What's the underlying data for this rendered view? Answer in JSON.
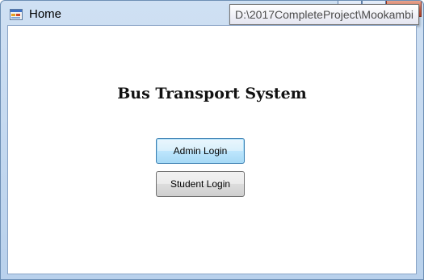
{
  "window": {
    "title": "Home",
    "tooltip": "D:\\2017CompleteProject\\Mookambi"
  },
  "caption": {
    "minimize_glyph": "–",
    "maximize_glyph": "☐",
    "close_glyph": "✕"
  },
  "main": {
    "heading": "Bus Transport System",
    "admin_login_label": "Admin Login",
    "student_login_label": "Student Login"
  }
}
